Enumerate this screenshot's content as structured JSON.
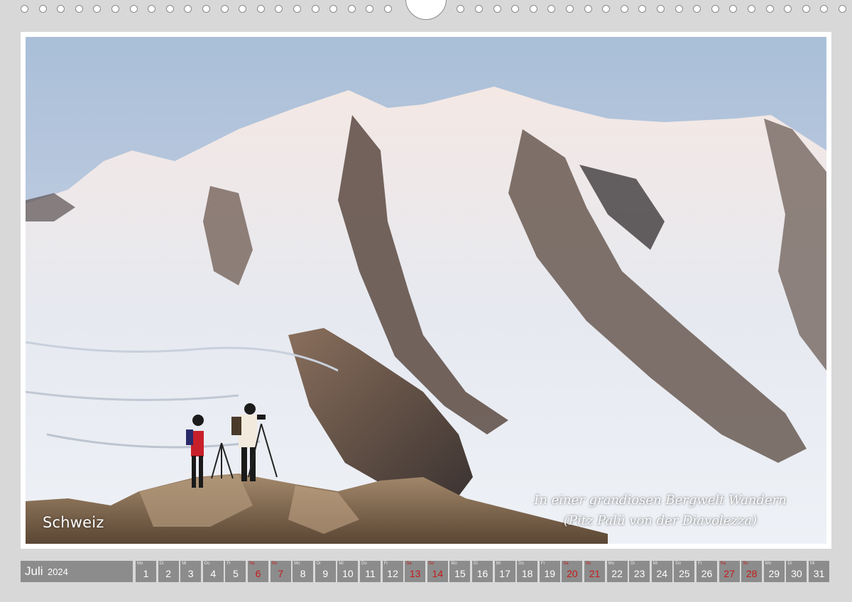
{
  "photo": {
    "region": "Schweiz",
    "caption_line1": "In einer grandiosen Bergwelt Wandern",
    "caption_line2": "(Pitz Palü  von der Diavolezza)"
  },
  "calendar": {
    "month": "Juli",
    "year": "2024",
    "weekend_color": "#c41b1b",
    "days": [
      {
        "dow": "Mo",
        "num": "1",
        "weekend": false
      },
      {
        "dow": "Di",
        "num": "2",
        "weekend": false
      },
      {
        "dow": "Mi",
        "num": "3",
        "weekend": false
      },
      {
        "dow": "Do",
        "num": "4",
        "weekend": false
      },
      {
        "dow": "Fr",
        "num": "5",
        "weekend": false
      },
      {
        "dow": "Sa",
        "num": "6",
        "weekend": true
      },
      {
        "dow": "So",
        "num": "7",
        "weekend": true
      },
      {
        "dow": "Mo",
        "num": "8",
        "weekend": false
      },
      {
        "dow": "Di",
        "num": "9",
        "weekend": false
      },
      {
        "dow": "Mi",
        "num": "10",
        "weekend": false
      },
      {
        "dow": "Do",
        "num": "11",
        "weekend": false
      },
      {
        "dow": "Fr",
        "num": "12",
        "weekend": false
      },
      {
        "dow": "Sa",
        "num": "13",
        "weekend": true
      },
      {
        "dow": "So",
        "num": "14",
        "weekend": true
      },
      {
        "dow": "Mo",
        "num": "15",
        "weekend": false
      },
      {
        "dow": "Di",
        "num": "16",
        "weekend": false
      },
      {
        "dow": "Mi",
        "num": "17",
        "weekend": false
      },
      {
        "dow": "Do",
        "num": "18",
        "weekend": false
      },
      {
        "dow": "Fr",
        "num": "19",
        "weekend": false
      },
      {
        "dow": "Sa",
        "num": "20",
        "weekend": true
      },
      {
        "dow": "So",
        "num": "21",
        "weekend": true
      },
      {
        "dow": "Mo",
        "num": "22",
        "weekend": false
      },
      {
        "dow": "Di",
        "num": "23",
        "weekend": false
      },
      {
        "dow": "Mi",
        "num": "24",
        "weekend": false
      },
      {
        "dow": "Do",
        "num": "25",
        "weekend": false
      },
      {
        "dow": "Fr",
        "num": "26",
        "weekend": false
      },
      {
        "dow": "Sa",
        "num": "27",
        "weekend": true
      },
      {
        "dow": "So",
        "num": "28",
        "weekend": true
      },
      {
        "dow": "Mo",
        "num": "29",
        "weekend": false
      },
      {
        "dow": "Di",
        "num": "30",
        "weekend": false
      },
      {
        "dow": "Mi",
        "num": "31",
        "weekend": false
      }
    ]
  }
}
